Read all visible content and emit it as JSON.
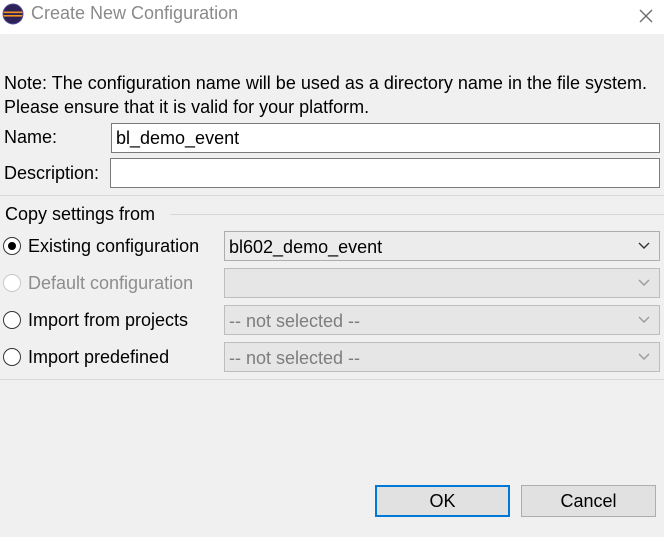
{
  "window": {
    "title": "Create New Configuration",
    "icon": "eclipse-icon",
    "close_icon": "close-icon"
  },
  "note": "Note: The configuration name will be used as a directory name in the file system.  Please ensure that it is valid for your platform.",
  "form": {
    "name_label": "Name:",
    "name_value": "bl_demo_event",
    "description_label": "Description:",
    "description_value": ""
  },
  "copy_settings": {
    "title": "Copy settings from",
    "options": [
      {
        "label": "Existing configuration",
        "selected": true,
        "enabled": true,
        "combo_value": "bl602_demo_event",
        "combo_enabled": true
      },
      {
        "label": "Default configuration",
        "selected": false,
        "enabled": false,
        "combo_value": "",
        "combo_enabled": false
      },
      {
        "label": "Import from projects",
        "selected": false,
        "enabled": true,
        "combo_value": "-- not selected --",
        "combo_enabled": false
      },
      {
        "label": "Import predefined",
        "selected": false,
        "enabled": true,
        "combo_value": "-- not selected --",
        "combo_enabled": false
      }
    ]
  },
  "buttons": {
    "ok": "OK",
    "cancel": "Cancel"
  },
  "colors": {
    "accent": "#0078d7",
    "dialog_bg": "#f0f0f0"
  }
}
